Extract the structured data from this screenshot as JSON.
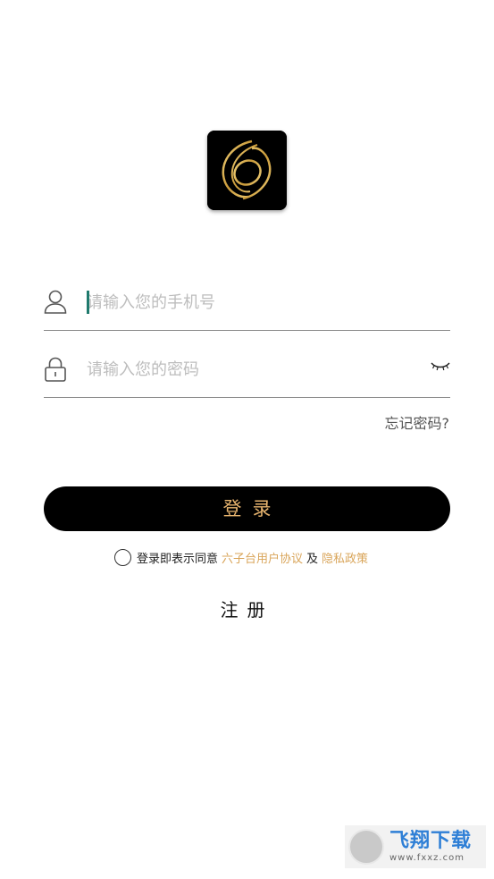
{
  "app": {
    "logo_name": "six-logo",
    "accent_color": "#e6b36e",
    "link_color": "#d9a55a"
  },
  "form": {
    "phone_placeholder": "请输入您的手机号",
    "password_placeholder": "请输入您的密码",
    "user_icon": "user-icon",
    "lock_icon": "lock-icon",
    "eye_icon": "eye-closed-icon",
    "forgot_label": "忘记密码?"
  },
  "login": {
    "button_label": "登录"
  },
  "agreement": {
    "prefix": "登录即表示同意",
    "user_agreement": "六子台用户协议",
    "and": "及",
    "privacy_policy": "隐私政策"
  },
  "register": {
    "label": "注册"
  },
  "watermark": {
    "title": "飞翔下载",
    "url": "www.fxxz.com"
  }
}
